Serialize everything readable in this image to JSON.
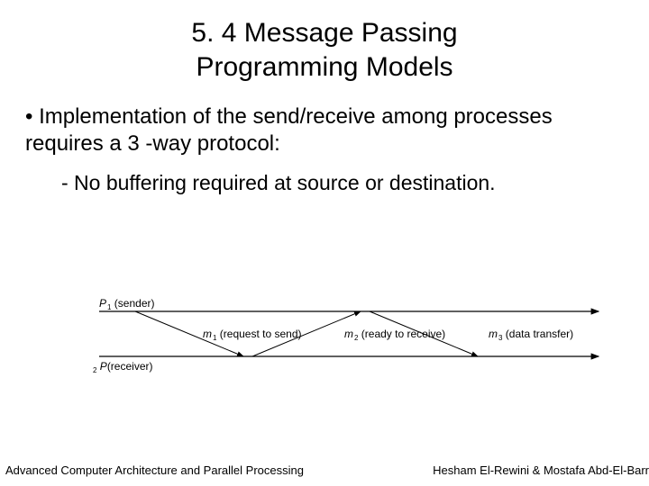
{
  "title_line1": "5. 4 Message Passing",
  "title_line2": "Programming Models",
  "bullet_main": "• Implementation of the send/receive among processes requires a 3 -way protocol:",
  "bullet_sub": "- No buffering required at source or destination.",
  "diagram": {
    "p1": "P",
    "p1_sub": "1",
    "p1_role": " (sender)",
    "m1": "m",
    "m1_sub": "1",
    "m1_role": " (request to send)",
    "m2": "m",
    "m2_sub": "2",
    "m2_role": "  (ready to receive)",
    "m3": "m",
    "m3_sub": "3",
    "m3_role": " (data transfer)",
    "p2_sub": "2",
    "p2": "P",
    "p2_role": "(receiver)"
  },
  "footer_left": "Advanced Computer Architecture and Parallel Processing",
  "footer_right": "Hesham El-Rewini & Mostafa Abd-El-Barr"
}
